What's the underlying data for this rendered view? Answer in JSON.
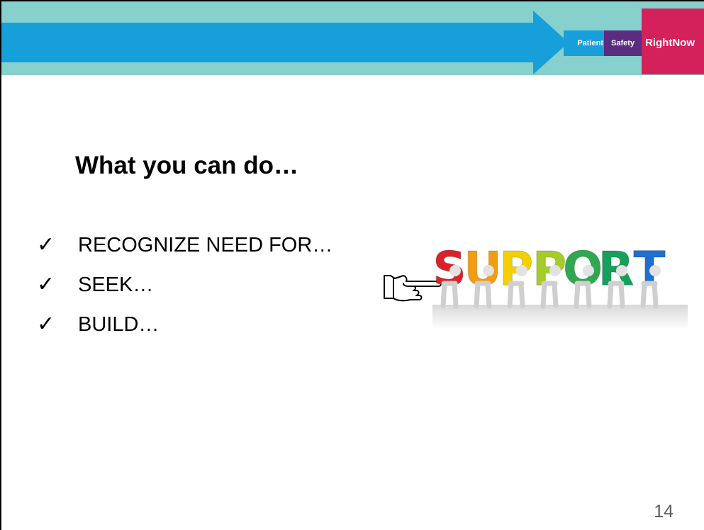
{
  "header": {
    "logo_patient": "Patient",
    "logo_safety": "Safety",
    "logo_right": "RightNow",
    "colors": {
      "teal": "#86d0cd",
      "blue": "#179fda",
      "purple": "#5a2d81",
      "magenta": "#d4215b"
    }
  },
  "slide": {
    "title": "What you can do…",
    "bullets": [
      {
        "icon": "check-icon",
        "label": "RECOGNIZE NEED FOR…"
      },
      {
        "icon": "check-icon",
        "label": "SEEK…"
      },
      {
        "icon": "check-icon",
        "label": "BUILD…"
      }
    ],
    "pointer_icon": "pointing-hand-icon",
    "image": {
      "letters": [
        "S",
        "U",
        "P",
        "P",
        "O",
        "R",
        "T"
      ],
      "letter_colors": [
        "#d9232a",
        "#f39c12",
        "#f5d000",
        "#a6cc2a",
        "#2fa84f",
        "#16a05c",
        "#1f6fd1"
      ]
    },
    "page_number": "14"
  }
}
